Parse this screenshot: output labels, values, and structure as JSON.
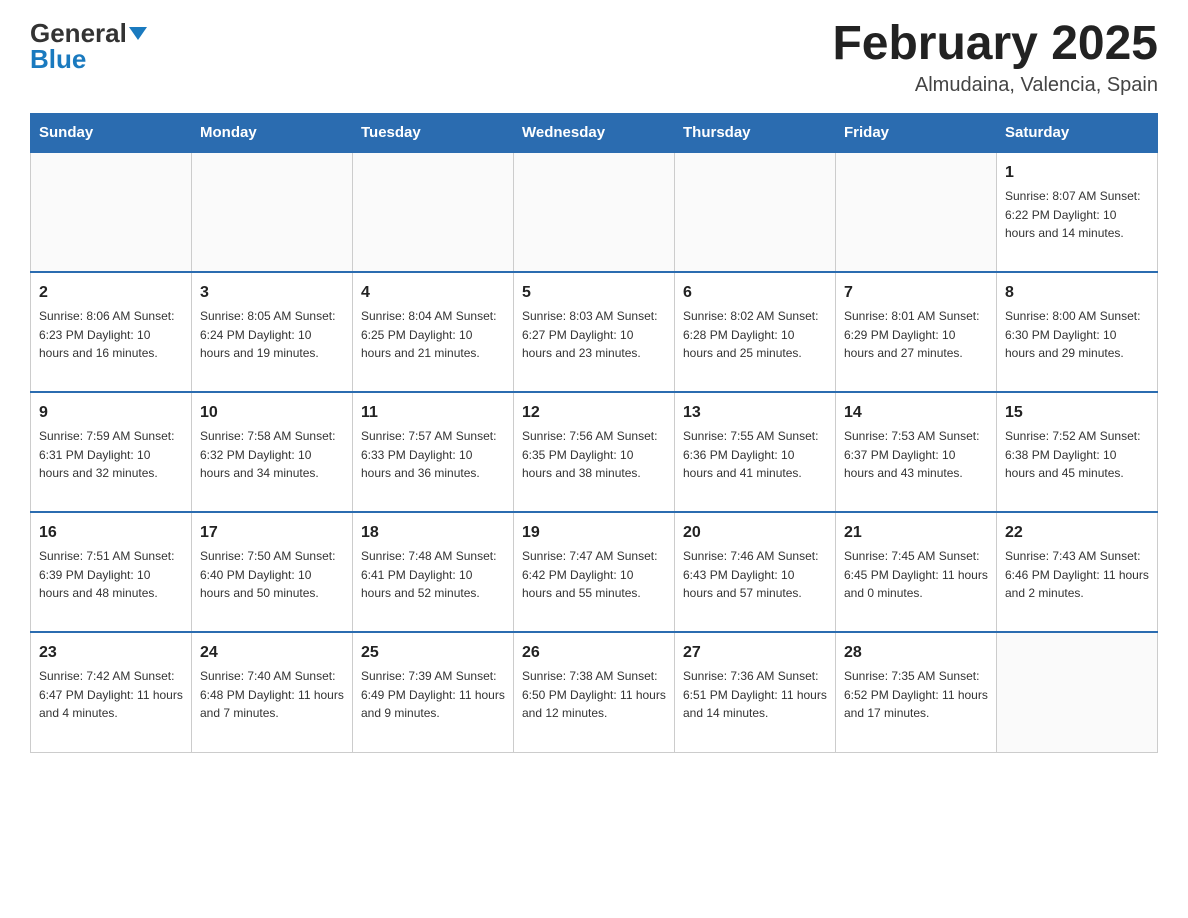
{
  "header": {
    "logo_general": "General",
    "logo_blue": "Blue",
    "title": "February 2025",
    "location": "Almudaina, Valencia, Spain"
  },
  "days_of_week": [
    "Sunday",
    "Monday",
    "Tuesday",
    "Wednesday",
    "Thursday",
    "Friday",
    "Saturday"
  ],
  "weeks": [
    [
      {
        "day": "",
        "info": ""
      },
      {
        "day": "",
        "info": ""
      },
      {
        "day": "",
        "info": ""
      },
      {
        "day": "",
        "info": ""
      },
      {
        "day": "",
        "info": ""
      },
      {
        "day": "",
        "info": ""
      },
      {
        "day": "1",
        "info": "Sunrise: 8:07 AM\nSunset: 6:22 PM\nDaylight: 10 hours\nand 14 minutes."
      }
    ],
    [
      {
        "day": "2",
        "info": "Sunrise: 8:06 AM\nSunset: 6:23 PM\nDaylight: 10 hours\nand 16 minutes."
      },
      {
        "day": "3",
        "info": "Sunrise: 8:05 AM\nSunset: 6:24 PM\nDaylight: 10 hours\nand 19 minutes."
      },
      {
        "day": "4",
        "info": "Sunrise: 8:04 AM\nSunset: 6:25 PM\nDaylight: 10 hours\nand 21 minutes."
      },
      {
        "day": "5",
        "info": "Sunrise: 8:03 AM\nSunset: 6:27 PM\nDaylight: 10 hours\nand 23 minutes."
      },
      {
        "day": "6",
        "info": "Sunrise: 8:02 AM\nSunset: 6:28 PM\nDaylight: 10 hours\nand 25 minutes."
      },
      {
        "day": "7",
        "info": "Sunrise: 8:01 AM\nSunset: 6:29 PM\nDaylight: 10 hours\nand 27 minutes."
      },
      {
        "day": "8",
        "info": "Sunrise: 8:00 AM\nSunset: 6:30 PM\nDaylight: 10 hours\nand 29 minutes."
      }
    ],
    [
      {
        "day": "9",
        "info": "Sunrise: 7:59 AM\nSunset: 6:31 PM\nDaylight: 10 hours\nand 32 minutes."
      },
      {
        "day": "10",
        "info": "Sunrise: 7:58 AM\nSunset: 6:32 PM\nDaylight: 10 hours\nand 34 minutes."
      },
      {
        "day": "11",
        "info": "Sunrise: 7:57 AM\nSunset: 6:33 PM\nDaylight: 10 hours\nand 36 minutes."
      },
      {
        "day": "12",
        "info": "Sunrise: 7:56 AM\nSunset: 6:35 PM\nDaylight: 10 hours\nand 38 minutes."
      },
      {
        "day": "13",
        "info": "Sunrise: 7:55 AM\nSunset: 6:36 PM\nDaylight: 10 hours\nand 41 minutes."
      },
      {
        "day": "14",
        "info": "Sunrise: 7:53 AM\nSunset: 6:37 PM\nDaylight: 10 hours\nand 43 minutes."
      },
      {
        "day": "15",
        "info": "Sunrise: 7:52 AM\nSunset: 6:38 PM\nDaylight: 10 hours\nand 45 minutes."
      }
    ],
    [
      {
        "day": "16",
        "info": "Sunrise: 7:51 AM\nSunset: 6:39 PM\nDaylight: 10 hours\nand 48 minutes."
      },
      {
        "day": "17",
        "info": "Sunrise: 7:50 AM\nSunset: 6:40 PM\nDaylight: 10 hours\nand 50 minutes."
      },
      {
        "day": "18",
        "info": "Sunrise: 7:48 AM\nSunset: 6:41 PM\nDaylight: 10 hours\nand 52 minutes."
      },
      {
        "day": "19",
        "info": "Sunrise: 7:47 AM\nSunset: 6:42 PM\nDaylight: 10 hours\nand 55 minutes."
      },
      {
        "day": "20",
        "info": "Sunrise: 7:46 AM\nSunset: 6:43 PM\nDaylight: 10 hours\nand 57 minutes."
      },
      {
        "day": "21",
        "info": "Sunrise: 7:45 AM\nSunset: 6:45 PM\nDaylight: 11 hours\nand 0 minutes."
      },
      {
        "day": "22",
        "info": "Sunrise: 7:43 AM\nSunset: 6:46 PM\nDaylight: 11 hours\nand 2 minutes."
      }
    ],
    [
      {
        "day": "23",
        "info": "Sunrise: 7:42 AM\nSunset: 6:47 PM\nDaylight: 11 hours\nand 4 minutes."
      },
      {
        "day": "24",
        "info": "Sunrise: 7:40 AM\nSunset: 6:48 PM\nDaylight: 11 hours\nand 7 minutes."
      },
      {
        "day": "25",
        "info": "Sunrise: 7:39 AM\nSunset: 6:49 PM\nDaylight: 11 hours\nand 9 minutes."
      },
      {
        "day": "26",
        "info": "Sunrise: 7:38 AM\nSunset: 6:50 PM\nDaylight: 11 hours\nand 12 minutes."
      },
      {
        "day": "27",
        "info": "Sunrise: 7:36 AM\nSunset: 6:51 PM\nDaylight: 11 hours\nand 14 minutes."
      },
      {
        "day": "28",
        "info": "Sunrise: 7:35 AM\nSunset: 6:52 PM\nDaylight: 11 hours\nand 17 minutes."
      },
      {
        "day": "",
        "info": ""
      }
    ]
  ]
}
